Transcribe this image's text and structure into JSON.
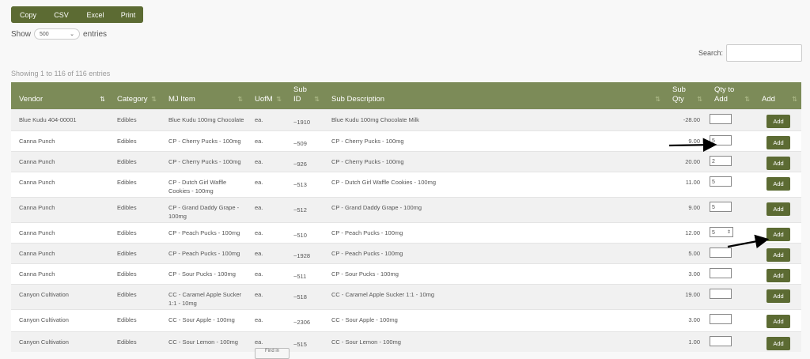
{
  "toolbar": {
    "buttons": [
      "Copy",
      "CSV",
      "Excel",
      "Print"
    ]
  },
  "length": {
    "prefix": "Show",
    "value": "500",
    "suffix": "entries"
  },
  "search": {
    "label": "Search:",
    "value": ""
  },
  "info": "Showing 1 to 116 of 116 entries",
  "table": {
    "columns": [
      "Vendor",
      "Category",
      "MJ Item",
      "UofM",
      "Sub ID",
      "Sub Description",
      "Sub Qty",
      "Qty to Add",
      "Add"
    ],
    "rows": [
      {
        "vendor": "Blue Kudu 404-00001",
        "category": "Edibles",
        "item": "Blue Kudu 100mg Chocolate",
        "uofm": "ea.",
        "subid": "~1910",
        "desc": "Blue Kudu 100mg Chocolate Milk",
        "subqty": "-28.00",
        "qty": "",
        "add": "Add"
      },
      {
        "vendor": "Canna Punch",
        "category": "Edibles",
        "item": "CP - Cherry Pucks - 100mg",
        "uofm": "ea.",
        "subid": "~509",
        "desc": "CP - Cherry Pucks - 100mg",
        "subqty": "9.00",
        "qty": "5",
        "add": "Add"
      },
      {
        "vendor": "Canna Punch",
        "category": "Edibles",
        "item": "CP - Cherry Pucks - 100mg",
        "uofm": "ea.",
        "subid": "~926",
        "desc": "CP - Cherry Pucks - 100mg",
        "subqty": "20.00",
        "qty": "2",
        "add": "Add"
      },
      {
        "vendor": "Canna Punch",
        "category": "Edibles",
        "item": "CP - Dutch Girl Waffle Cookies - 100mg",
        "uofm": "ea.",
        "subid": "~513",
        "desc": "CP - Dutch Girl Waffle Cookies - 100mg",
        "subqty": "11.00",
        "qty": "5",
        "add": "Add"
      },
      {
        "vendor": "Canna Punch",
        "category": "Edibles",
        "item": "CP - Grand Daddy Grape - 100mg",
        "uofm": "ea.",
        "subid": "~512",
        "desc": "CP - Grand Daddy Grape - 100mg",
        "subqty": "9.00",
        "qty": "5",
        "add": "Add"
      },
      {
        "vendor": "Canna Punch",
        "category": "Edibles",
        "item": "CP - Peach Pucks - 100mg",
        "uofm": "ea.",
        "subid": "~510",
        "desc": "CP - Peach Pucks - 100mg",
        "subqty": "12.00",
        "qty": "5",
        "add": "Add"
      },
      {
        "vendor": "Canna Punch",
        "category": "Edibles",
        "item": "CP - Peach Pucks - 100mg",
        "uofm": "ea.",
        "subid": "~1928",
        "desc": "CP - Peach Pucks - 100mg",
        "subqty": "5.00",
        "qty": "",
        "add": "Add"
      },
      {
        "vendor": "Canna Punch",
        "category": "Edibles",
        "item": "CP - Sour Pucks - 100mg",
        "uofm": "ea.",
        "subid": "~511",
        "desc": "CP - Sour Pucks - 100mg",
        "subqty": "3.00",
        "qty": "",
        "add": "Add"
      },
      {
        "vendor": "Canyon Cultivation",
        "category": "Edibles",
        "item": "CC - Caramel Apple Sucker 1:1 - 10mg",
        "uofm": "ea.",
        "subid": "~518",
        "desc": "CC - Caramel Apple Sucker 1:1 - 10mg",
        "subqty": "19.00",
        "qty": "",
        "add": "Add"
      },
      {
        "vendor": "Canyon Cultivation",
        "category": "Edibles",
        "item": "CC - Sour Apple - 100mg",
        "uofm": "ea.",
        "subid": "~2306",
        "desc": "CC - Sour Apple - 100mg",
        "subqty": "3.00",
        "qty": "",
        "add": "Add"
      },
      {
        "vendor": "Canyon Cultivation",
        "category": "Edibles",
        "item": "CC - Sour Lemon - 100mg",
        "uofm": "ea.",
        "subid": "~515",
        "desc": "CC - Sour Lemon - 100mg",
        "subqty": "1.00",
        "qty": "",
        "add": "Add"
      }
    ]
  },
  "tooltip": "Find in",
  "colors": {
    "header": "#7c8b58",
    "button": "#5c6b33",
    "arrow": "#000000"
  }
}
